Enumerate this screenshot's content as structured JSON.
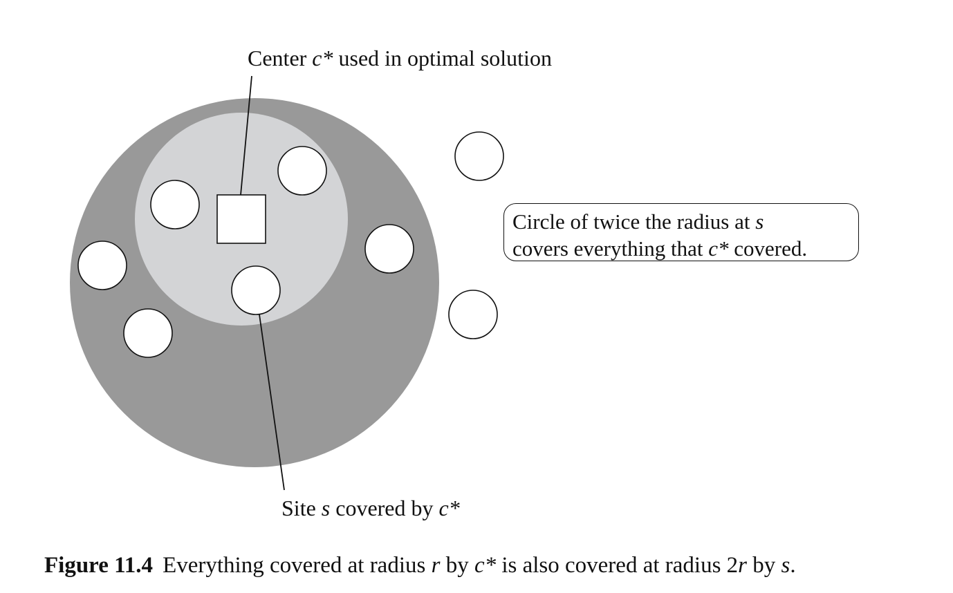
{
  "labels": {
    "center": {
      "prefix": "Center ",
      "var": "c*",
      "suffix": " used in optimal solution"
    },
    "site": {
      "prefix": "Site ",
      "var": "s",
      "middle": " covered by ",
      "var2": "c*"
    }
  },
  "callout": {
    "line1_prefix": "Circle of twice the radius at ",
    "line1_var": "s",
    "line2_prefix": "covers everything that ",
    "line2_var": "c*",
    "line2_suffix": " covered."
  },
  "caption": {
    "figure_number": "Figure 11.4",
    "t1": "Everything covered at radius ",
    "v1": "r",
    "t2": " by ",
    "v2": "c*",
    "t3": " is also covered at radius 2",
    "v3": "r",
    "t4": " by ",
    "v4": "s",
    "t5": "."
  },
  "colors": {
    "outer_disk": "#999999",
    "inner_disk": "#d3d4d6",
    "site_fill": "#ffffff",
    "stroke": "#111111"
  },
  "icons": {
    "site_marker": "circle",
    "center_marker": "square"
  }
}
